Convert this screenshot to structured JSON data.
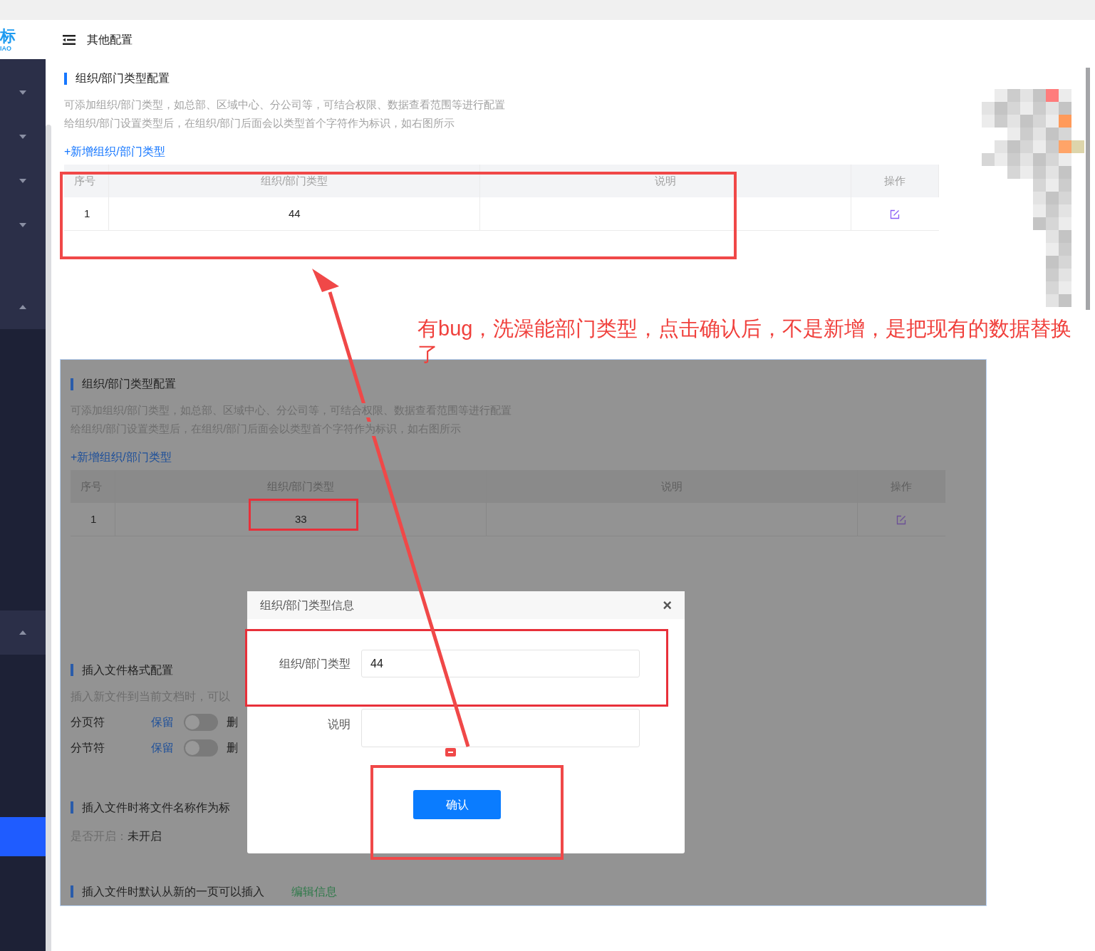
{
  "logo": {
    "mark": "标",
    "sub": "IAO"
  },
  "header": {
    "title": "其他配置"
  },
  "sidebar": {
    "items": [
      {
        "kind": "group",
        "expanded": false
      },
      {
        "kind": "group",
        "expanded": false
      },
      {
        "kind": "group",
        "expanded": false
      },
      {
        "kind": "group",
        "expanded": false
      },
      {
        "kind": "group",
        "expanded": true
      },
      {
        "kind": "group",
        "expanded": true
      },
      {
        "kind": "item",
        "selected": true
      }
    ]
  },
  "section": {
    "title": "组织/部门类型配置",
    "description": [
      "可添加组织/部门类型，如总部、区域中心、分公司等，可结合权限、数据查看范围等进行配置",
      "给组织/部门设置类型后，在组织/部门后面会以类型首个字符作为标识，如右图所示"
    ],
    "add_link": "+新增组织/部门类型",
    "table": {
      "columns": [
        "序号",
        "组织/部门类型",
        "说明",
        "操作"
      ],
      "rows": [
        {
          "index": "1",
          "type": "44"
        }
      ]
    }
  },
  "annotation": {
    "text": "有bug，洗澡能部门类型，点击确认后，不是新增，是把现有的数据替换了"
  },
  "embedded_screenshot": {
    "section": {
      "title": "组织/部门类型配置",
      "description": [
        "可添加组织/部门类型，如总部、区域中心、分公司等，可结合权限、数据查看范围等进行配置",
        "给组织/部门设置类型后，在组织/部门后面会以类型首个字符作为标识，如右图所示"
      ],
      "add_link": "+新增组织/部门类型",
      "table": {
        "columns": [
          "序号",
          "组织/部门类型",
          "说明",
          "操作"
        ],
        "rows": [
          {
            "index": "1",
            "type": "33"
          }
        ]
      }
    },
    "insert_format": {
      "title": "插入文件格式配置",
      "description": "插入新文件到当前文档时，可以",
      "toggles": [
        {
          "label": "分页符",
          "left": "保留",
          "on": false,
          "right": "删"
        },
        {
          "label": "分节符",
          "left": "保留",
          "on": false,
          "right": "删"
        }
      ]
    },
    "filename_title": {
      "title": "插入文件时将文件名称作为标",
      "status_label": "是否开启：",
      "status_value": "未开启"
    },
    "new_page": {
      "title": "插入文件时默认从新的一页可以插入",
      "link": "编辑信息"
    },
    "dialog": {
      "title": "组织/部门类型信息",
      "close": "×",
      "fields": [
        {
          "label": "组织/部门类型",
          "value": "44"
        },
        {
          "label": "说明"
        }
      ],
      "confirm": "确认"
    }
  }
}
